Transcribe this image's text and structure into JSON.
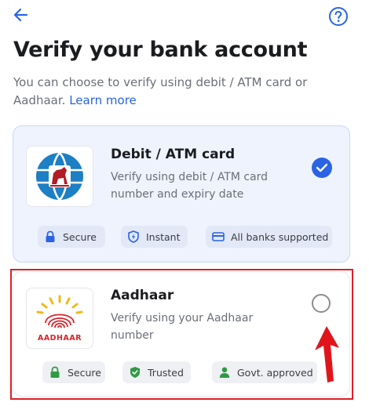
{
  "header": {
    "back_icon": "back-arrow-icon",
    "help_icon": "help-circle-icon",
    "title": "Verify your bank account",
    "subtitle": "You can choose to verify using debit / ATM card or Aadhaar.",
    "learn_more": "Learn more"
  },
  "options": [
    {
      "id": "debit",
      "title": "Debit / ATM card",
      "description": "Verify using debit / ATM card number and expiry date",
      "selected": true,
      "logo": "bank-emblem-logo",
      "chips": [
        {
          "label": "Secure",
          "icon": "lock-icon"
        },
        {
          "label": "Instant",
          "icon": "shield-lightning-icon"
        },
        {
          "label": "All banks supported",
          "icon": "card-icon"
        }
      ]
    },
    {
      "id": "aadhaar",
      "title": "Aadhaar",
      "description": "Verify using your Aadhaar number",
      "selected": false,
      "logo": "aadhaar-logo",
      "logo_text": "AADHAAR",
      "chips": [
        {
          "label": "Secure",
          "icon": "lock-icon"
        },
        {
          "label": "Trusted",
          "icon": "shield-check-icon"
        },
        {
          "label": "Govt. approved",
          "icon": "person-icon"
        }
      ]
    }
  ],
  "colors": {
    "accent": "#2a63e4",
    "selected_card_bg": "#eef3fe",
    "annotation_red": "#dd1f26",
    "chip_green": "#2f9a44"
  }
}
